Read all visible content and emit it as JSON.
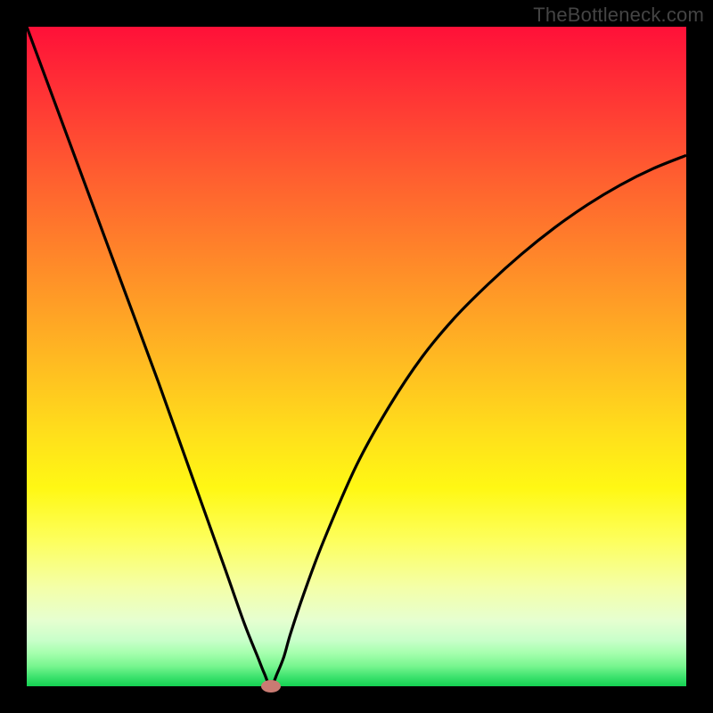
{
  "attribution": "TheBottleneck.com",
  "colors": {
    "page_bg": "#000000",
    "curve_stroke": "#000000",
    "marker_fill": "#c97b73",
    "gradient_stops": [
      "#ff1038",
      "#ff2c36",
      "#ff5c30",
      "#ff8a29",
      "#ffb822",
      "#ffe01b",
      "#fff814",
      "#fdff5e",
      "#f4ffa8",
      "#e6ffd0",
      "#c9ffca",
      "#a5ffad",
      "#76f58e",
      "#3fe36f",
      "#14d152"
    ]
  },
  "chart_data": {
    "type": "line",
    "title": "",
    "xlabel": "",
    "ylabel": "",
    "xlim": [
      0,
      100
    ],
    "ylim": [
      0,
      100
    ],
    "min_point": {
      "x": 37,
      "y": 0
    },
    "series": [
      {
        "name": "bottleneck-curve",
        "x": [
          0,
          5,
          10,
          15,
          20,
          25,
          30,
          33,
          35,
          36,
          37,
          38,
          39,
          40,
          42,
          45,
          50,
          55,
          60,
          65,
          70,
          75,
          80,
          85,
          90,
          95,
          100
        ],
        "values": [
          100,
          86.5,
          73,
          59.5,
          46,
          32,
          18,
          9.5,
          4.5,
          2,
          0,
          2,
          4.5,
          8,
          14,
          22,
          33.5,
          42.5,
          50,
          56,
          61,
          65.5,
          69.5,
          73,
          76,
          78.5,
          80.5
        ]
      }
    ],
    "marker": {
      "x": 37,
      "y": 0
    }
  }
}
